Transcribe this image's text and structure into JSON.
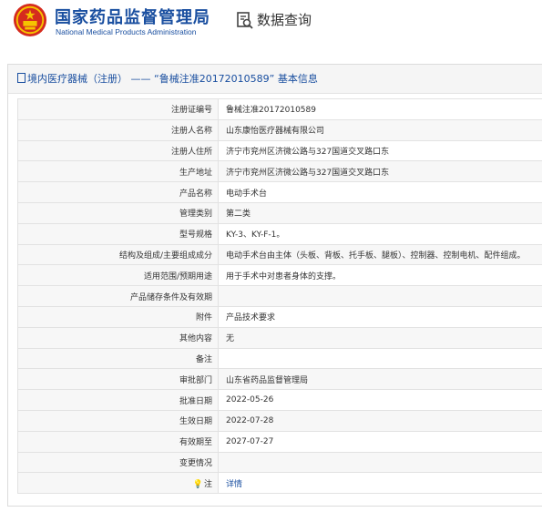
{
  "header": {
    "title_cn": "国家药品监督管理局",
    "title_en": "National Medical Products Administration",
    "section_title": "数据查询"
  },
  "panel": {
    "title": "境内医疗器械（注册） —— “鲁械注准20172010589” 基本信息"
  },
  "rows": [
    {
      "label": "注册证编号",
      "value": "鲁械注准20172010589"
    },
    {
      "label": "注册人名称",
      "value": "山东康怡医疗器械有限公司"
    },
    {
      "label": "注册人住所",
      "value": "济宁市兖州区济微公路与327国道交叉路口东"
    },
    {
      "label": "生产地址",
      "value": "济宁市兖州区济微公路与327国道交叉路口东"
    },
    {
      "label": "产品名称",
      "value": "电动手术台"
    },
    {
      "label": "管理类别",
      "value": "第二类"
    },
    {
      "label": "型号规格",
      "value": "KY-3、KY-F-1。"
    },
    {
      "label": "结构及组成/主要组成成分",
      "value": "电动手术台由主体（头板、背板、托手板、腿板）、控制器、控制电机、配件组成。"
    },
    {
      "label": "适用范围/预期用途",
      "value": "用于手术中对患者身体的支撑。"
    },
    {
      "label": "产品储存条件及有效期",
      "value": ""
    },
    {
      "label": "附件",
      "value": "产品技术要求"
    },
    {
      "label": "其他内容",
      "value": "无"
    },
    {
      "label": "备注",
      "value": ""
    },
    {
      "label": "审批部门",
      "value": "山东省药品监督管理局"
    },
    {
      "label": "批准日期",
      "value": "2022-05-26"
    },
    {
      "label": "生效日期",
      "value": "2022-07-28"
    },
    {
      "label": "有效期至",
      "value": "2027-07-27"
    },
    {
      "label": "变更情况",
      "value": ""
    },
    {
      "label": "注",
      "value": "详情",
      "link": true
    }
  ],
  "colors": {
    "brand_blue": "#1a4fa0",
    "emblem_red": "#d52b1e",
    "emblem_gold": "#f5c400"
  },
  "icons": {
    "emblem": "national-emblem",
    "section": "magnifier-doc-icon",
    "panel": "document-icon",
    "note": "lightbulb-icon"
  }
}
